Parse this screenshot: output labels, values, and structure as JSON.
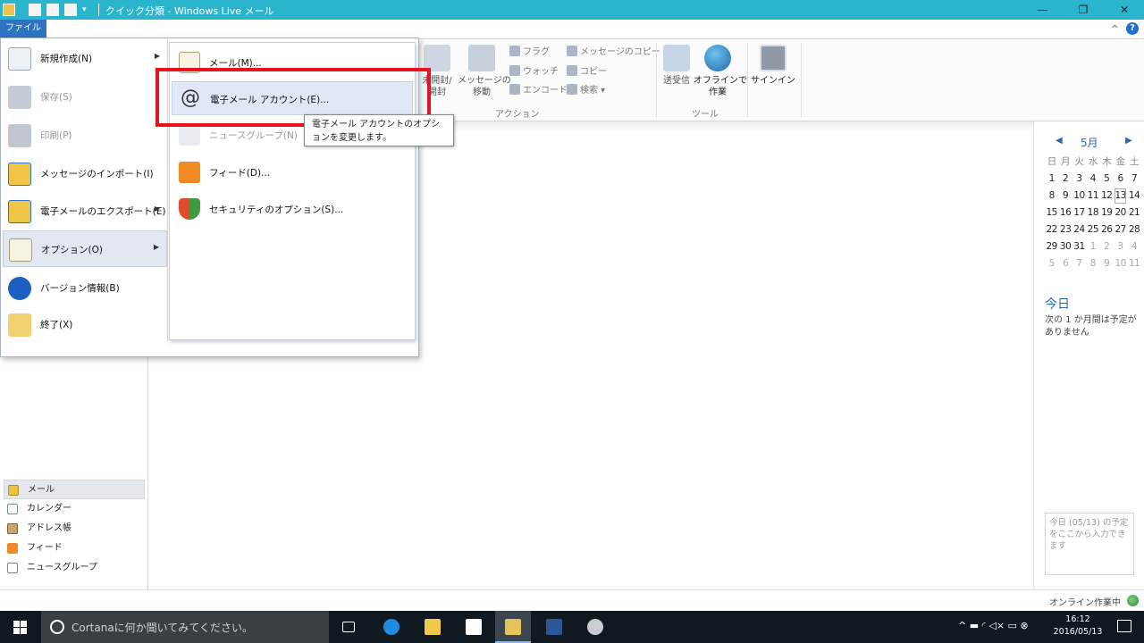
{
  "window": {
    "title": "クイック分類 - Windows Live メール",
    "file_tab": "ファイル",
    "min": "—",
    "max": "❐",
    "close": "✕",
    "collapse": "^",
    "help": "?"
  },
  "ribbon": {
    "big_buttons": [
      {
        "label": "未開封/\n開封",
        "icon": "envelope-icon"
      },
      {
        "label": "メッセージの\n移動",
        "icon": "move-folder-icon"
      },
      {
        "label": "送受信",
        "icon": "send-receive-icon"
      },
      {
        "label": "オフラインで\n作業",
        "icon": "offline-globe-icon"
      },
      {
        "label": "サインイン",
        "icon": "signin-icon"
      }
    ],
    "small_buttons": [
      "フラグ",
      "ウォッチ",
      "エンコード",
      "メッセージのコピー",
      "コピー",
      "検索"
    ],
    "groups": {
      "actions": "アクション",
      "tools": "ツール"
    }
  },
  "file_menu": {
    "items": [
      {
        "label": "新規作成(N)",
        "has_submenu": true,
        "disabled": false
      },
      {
        "label": "保存(S)",
        "has_submenu": false,
        "disabled": true
      },
      {
        "label": "印刷(P)",
        "has_submenu": false,
        "disabled": true
      },
      {
        "label": "メッセージのインポート(I)",
        "has_submenu": false,
        "disabled": false
      },
      {
        "label": "電子メールのエクスポート(E)",
        "has_submenu": true,
        "disabled": false
      },
      {
        "label": "オプション(O)",
        "has_submenu": true,
        "disabled": false,
        "selected": true
      },
      {
        "label": "バージョン情報(B)",
        "has_submenu": false,
        "disabled": false
      },
      {
        "label": "終了(X)",
        "has_submenu": false,
        "disabled": false
      }
    ],
    "submenu": [
      {
        "label": "メール(M)...",
        "disabled": false
      },
      {
        "label": "電子メール アカウント(E)...",
        "disabled": false,
        "selected": true
      },
      {
        "label": "ニュースグループ(N)",
        "disabled": true
      },
      {
        "label": "フィード(D)...",
        "disabled": false
      },
      {
        "label": "セキュリティのオプション(S)...",
        "disabled": false
      }
    ],
    "tooltip": "電子メール アカウントのオプションを変更します。"
  },
  "calendar": {
    "prev": "◀",
    "next": "▶",
    "month": "5月",
    "weekdays": [
      "日",
      "月",
      "火",
      "水",
      "木",
      "金",
      "土"
    ],
    "weeks": [
      [
        {
          "d": "1"
        },
        {
          "d": "2"
        },
        {
          "d": "3"
        },
        {
          "d": "4"
        },
        {
          "d": "5"
        },
        {
          "d": "6"
        },
        {
          "d": "7"
        }
      ],
      [
        {
          "d": "8"
        },
        {
          "d": "9"
        },
        {
          "d": "10"
        },
        {
          "d": "11"
        },
        {
          "d": "12"
        },
        {
          "d": "13",
          "today": true
        },
        {
          "d": "14"
        }
      ],
      [
        {
          "d": "15"
        },
        {
          "d": "16"
        },
        {
          "d": "17"
        },
        {
          "d": "18"
        },
        {
          "d": "19"
        },
        {
          "d": "20"
        },
        {
          "d": "21"
        }
      ],
      [
        {
          "d": "22"
        },
        {
          "d": "23"
        },
        {
          "d": "24"
        },
        {
          "d": "25"
        },
        {
          "d": "26"
        },
        {
          "d": "27"
        },
        {
          "d": "28"
        }
      ],
      [
        {
          "d": "29"
        },
        {
          "d": "30"
        },
        {
          "d": "31"
        },
        {
          "d": "1",
          "muted": true
        },
        {
          "d": "2",
          "muted": true
        },
        {
          "d": "3",
          "muted": true
        },
        {
          "d": "4",
          "muted": true
        }
      ],
      [
        {
          "d": "5",
          "muted": true
        },
        {
          "d": "6",
          "muted": true
        },
        {
          "d": "7",
          "muted": true
        },
        {
          "d": "8",
          "muted": true
        },
        {
          "d": "9",
          "muted": true
        },
        {
          "d": "10",
          "muted": true
        },
        {
          "d": "11",
          "muted": true
        }
      ]
    ],
    "today_title": "今日",
    "today_text": "次の 1 か月間は予定がありません",
    "quick_add_placeholder": "今日 (05/13) の予定をここから入力できます"
  },
  "nav": [
    {
      "label": "メール",
      "icon": "mail-icon",
      "selected": true
    },
    {
      "label": "カレンダー",
      "icon": "calendar-icon"
    },
    {
      "label": "アドレス帳",
      "icon": "address-book-icon"
    },
    {
      "label": "フィード",
      "icon": "feed-icon"
    },
    {
      "label": "ニュースグループ",
      "icon": "newsgroup-icon"
    }
  ],
  "status": {
    "text": "オンライン作業中"
  },
  "taskbar": {
    "search_placeholder": "Cortanaに何か聞いてみてください。",
    "time": "16:12",
    "date": "2016/05/13",
    "tray_glyphs": "^  ▬  ◜  ◁×  ▭  ⊗"
  },
  "colors": {
    "titlebar": "#2bb5cc",
    "file_tab": "#2d73c0",
    "highlight": "#e8121c",
    "taskbar": "#101820"
  }
}
